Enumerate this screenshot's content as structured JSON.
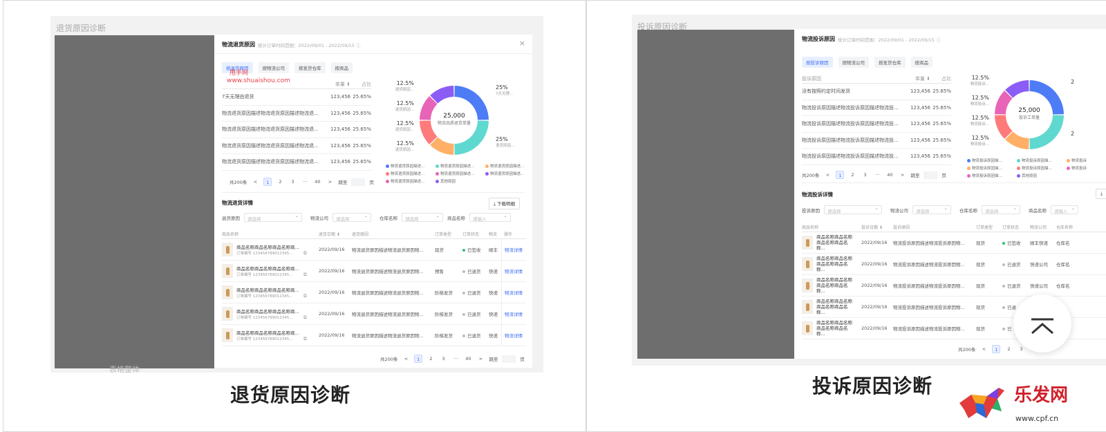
{
  "left": {
    "screenshot_title": "退货原因诊断",
    "caption": "退货原因诊断",
    "bottom_hint": "表格整体",
    "window": {
      "title": "物流退货原因",
      "subtitle": "统计订单时间范围：2022/09/01 - 2022/09/15 ⓘ",
      "close_icon": "×",
      "tabs": [
        "按退货原因",
        "按物流公司",
        "按发货仓库",
        "按商品"
      ],
      "watermark_line1": "甩手网",
      "watermark_line2": "www.shuaishou.com",
      "summary_headers": [
        "",
        "单量 ⬇",
        "占比"
      ],
      "summary_rows": [
        {
          "name": "7天无理由退货",
          "count": "123,456",
          "pct": "25.65%"
        },
        {
          "name": "物流退货原因描述物流退货原因描述物流退...",
          "count": "123,456",
          "pct": "25.65%"
        },
        {
          "name": "物流退货原因描述物流退货原因描述物流退...",
          "count": "123,456",
          "pct": "25.65%"
        },
        {
          "name": "物流退货原因描述物流退货原因描述物流退...",
          "count": "123,456",
          "pct": "25.65%"
        },
        {
          "name": "物流退货原因描述物流退货原因描述物流退...",
          "count": "123,456",
          "pct": "25.65%"
        }
      ],
      "pager": {
        "total": "共200条",
        "prev": "<",
        "pages": [
          "1",
          "2",
          "3",
          "···",
          "40"
        ],
        "next": ">",
        "goto": "跳至",
        "unit": "页"
      },
      "donut": {
        "center_value": "25,000",
        "center_label": "物流品质退货单量",
        "slices": [
          {
            "value": 25,
            "color": "#4d7cf6"
          },
          {
            "value": 25,
            "color": "#5fd8d0"
          },
          {
            "value": 12.5,
            "color": "#ffb066"
          },
          {
            "value": 12.5,
            "color": "#ff7a7a"
          },
          {
            "value": 12.5,
            "color": "#e864b7"
          },
          {
            "value": 12.5,
            "color": "#8b5cf6"
          }
        ],
        "labels_left": [
          {
            "pct": "12.5%",
            "label": "退货原因..."
          },
          {
            "pct": "12.5%",
            "label": "退货原因..."
          },
          {
            "pct": "12.5%",
            "label": "退货原因..."
          },
          {
            "pct": "12.5%",
            "label": "退货原因..."
          }
        ],
        "labels_right": [
          {
            "pct": "25%",
            "label": "7天无理..."
          },
          {
            "pct": "25%",
            "label": "退货原因..."
          }
        ]
      },
      "legend": [
        {
          "label": "物流退货原因描述...",
          "color": "#4d7cf6"
        },
        {
          "label": "物流退货原因描述...",
          "color": "#5fd8d0"
        },
        {
          "label": "物流退货原因描述...",
          "color": "#ffb066"
        },
        {
          "label": "物流退货原因描述...",
          "color": "#ff7a7a"
        },
        {
          "label": "物流退货原因描述...",
          "color": "#e864b7"
        },
        {
          "label": "物流退货原因描述...",
          "color": "#8b5cf6"
        },
        {
          "label": "物流退货原因描述...",
          "color": "#e864b7"
        },
        {
          "label": "其他原因",
          "color": "#8b5cf6"
        }
      ],
      "detail_title": "物流退货详情",
      "download_label": "⤓ 下载明细",
      "filters": [
        {
          "label": "退货原因",
          "placeholder": "请选择"
        },
        {
          "label": "物流公司",
          "placeholder": "请选择"
        },
        {
          "label": "仓库名称",
          "placeholder": "请选择"
        },
        {
          "label": "商品名称",
          "placeholder": "请输入"
        }
      ],
      "detail_headers": [
        "商品名称",
        "退货日期 ⬇",
        "退货原因",
        "订单类型",
        "订单状态",
        "物流",
        "操作"
      ],
      "detail_rows": [
        {
          "name": "商品名称商品名称商品名称商...",
          "order": "订单编号 123456789012345...",
          "date": "2022/09/16",
          "reason": "物流退货原因描述物流退货原因物...",
          "type": "现货",
          "status": "已签收",
          "status_dot": "g",
          "logistics": "顺丰",
          "op": "物流详情"
        },
        {
          "name": "商品名称商品名称商品名称商...",
          "order": "订单编号 123456789012345...",
          "date": "2022/09/16",
          "reason": "物流退货原因描述物流退货原因物...",
          "type": "预售",
          "status": "已退货",
          "status_dot": "",
          "logistics": "快递",
          "op": "物流详情"
        },
        {
          "name": "商品名称商品名称商品名称商...",
          "order": "订单编号 123456789012345...",
          "date": "2022/09/16",
          "reason": "物流退货原因描述物流退货原因物...",
          "type": "阶梯发货",
          "status": "已退货",
          "status_dot": "",
          "logistics": "快递",
          "op": "物流详情"
        },
        {
          "name": "商品名称商品名称商品名称商...",
          "order": "订单编号 123456789012345...",
          "date": "2022/09/16",
          "reason": "物流退货原因描述物流退货原因物...",
          "type": "阶梯发货",
          "status": "已退货",
          "status_dot": "",
          "logistics": "快递",
          "op": "物流详情"
        },
        {
          "name": "商品名称商品名称商品名称商...",
          "order": "订单编号 123456789012345...",
          "date": "2022/09/16",
          "reason": "物流退货原因描述物流退货原因物...",
          "type": "阶梯发货",
          "status": "已退货",
          "status_dot": "",
          "logistics": "快递",
          "op": "物流详情"
        }
      ]
    }
  },
  "right": {
    "screenshot_title": "投诉原因诊断",
    "caption": "投诉原因诊断",
    "window": {
      "title": "物流投诉原因",
      "subtitle": "统计订单时间范围：2022/09/01 - 2022/09/15 ⓘ",
      "tabs": [
        "按投诉原因",
        "按物流公司",
        "按发货仓库",
        "按商品"
      ],
      "summary_headers": [
        "投诉原因",
        "单量 ⬇",
        "占比"
      ],
      "summary_rows": [
        {
          "name": "没有按照约定时间发货",
          "count": "123,456",
          "pct": "25.65%"
        },
        {
          "name": "物流投诉原因描述物流投诉原因描述物流投...",
          "count": "123,456",
          "pct": "25.65%"
        },
        {
          "name": "物流投诉原因描述物流投诉原因描述物流投...",
          "count": "123,456",
          "pct": "25.65%"
        },
        {
          "name": "物流投诉原因描述物流投诉原因描述物流投...",
          "count": "123,456",
          "pct": "25.65%"
        },
        {
          "name": "物流投诉原因描述物流投诉原因描述物流投...",
          "count": "123,456",
          "pct": "25.65%"
        }
      ],
      "pager": {
        "total": "共200条",
        "prev": "<",
        "pages": [
          "1",
          "2",
          "3"
        ],
        "next": "",
        "goto": "",
        "unit": ""
      },
      "donut": {
        "center_value": "25,000",
        "center_label": "投诉工单量",
        "slices": [
          {
            "value": 25,
            "color": "#4d7cf6"
          },
          {
            "value": 25,
            "color": "#5fd8d0"
          },
          {
            "value": 12.5,
            "color": "#ffb066"
          },
          {
            "value": 12.5,
            "color": "#ff7a7a"
          },
          {
            "value": 12.5,
            "color": "#e864b7"
          },
          {
            "value": 12.5,
            "color": "#8b5cf6"
          }
        ],
        "labels_left": [
          {
            "pct": "12.5%",
            "label": "物流投诉..."
          },
          {
            "pct": "12.5%",
            "label": "物流投诉..."
          },
          {
            "pct": "12.5%",
            "label": "物流投诉..."
          },
          {
            "pct": "12.5%",
            "label": "物流投诉..."
          }
        ],
        "labels_right": [
          {
            "pct": "2",
            "label": ""
          },
          {
            "pct": "2",
            "label": ""
          }
        ]
      },
      "legend": [
        {
          "label": "物流投诉原因描...",
          "color": "#4d7cf6"
        },
        {
          "label": "物流投诉原因描...",
          "color": "#5fd8d0"
        },
        {
          "label": "物流投诉",
          "color": "#ffb066"
        },
        {
          "label": "物流投诉原因描...",
          "color": "#ffb066"
        },
        {
          "label": "物流投诉原因描...",
          "color": "#ff7a7a"
        },
        {
          "label": "物流投诉",
          "color": "#e864b7"
        },
        {
          "label": "物流投诉原因描...",
          "color": "#e864b7"
        },
        {
          "label": "其他原因",
          "color": "#8b5cf6"
        }
      ],
      "detail_title": "物流投诉详情",
      "download_label": "⤓",
      "filters": [
        {
          "label": "投诉原因",
          "placeholder": "请选择"
        },
        {
          "label": "物流公司",
          "placeholder": "请选择"
        },
        {
          "label": "仓库名称",
          "placeholder": "请选择"
        },
        {
          "label": "商品名称",
          "placeholder": "请输入"
        }
      ],
      "detail_headers": [
        "商品名称",
        "投诉日期 ⬇",
        "投诉原因",
        "订单类型",
        "订单状态",
        "物流公司",
        "仓库名称"
      ],
      "detail_rows": [
        {
          "name": "商品名称商品名称商品名称商品名称...",
          "date": "2022/09/16",
          "reason": "物流投诉原因描述物流投诉原因物...",
          "type": "现货",
          "status": "已签收",
          "status_dot": "g",
          "logistics": "顺丰快递",
          "warehouse": "仓库名"
        },
        {
          "name": "商品名称商品名称商品名称商品名称...",
          "date": "2022/09/16",
          "reason": "物流投诉原因描述物流投诉原因物...",
          "type": "现货",
          "status": "已退货",
          "status_dot": "",
          "logistics": "快递公司",
          "warehouse": "仓库名"
        },
        {
          "name": "商品名称商品名称商品名称商品名称...",
          "date": "2022/09/16",
          "reason": "物流投诉原因描述物流投诉原因物...",
          "type": "现货",
          "status": "已退货",
          "status_dot": "",
          "logistics": "快递公司",
          "warehouse": "仓库名"
        },
        {
          "name": "商品名称商品名称商品名称商品名称...",
          "date": "2022/09/16",
          "reason": "物流投诉原因描述物流投诉原因物...",
          "type": "现货",
          "status": "已退",
          "status_dot": "",
          "logistics": "",
          "warehouse": ""
        },
        {
          "name": "商品名称商品名称商品名称商品名称...",
          "date": "2022/09/16",
          "reason": "物流投诉原因描述物流投诉原因物...",
          "type": "现货",
          "status": "已",
          "status_dot": "",
          "logistics": "",
          "warehouse": ""
        }
      ]
    }
  },
  "brand": {
    "site": "www.cpf.cn",
    "logo_text": "乐发网"
  }
}
